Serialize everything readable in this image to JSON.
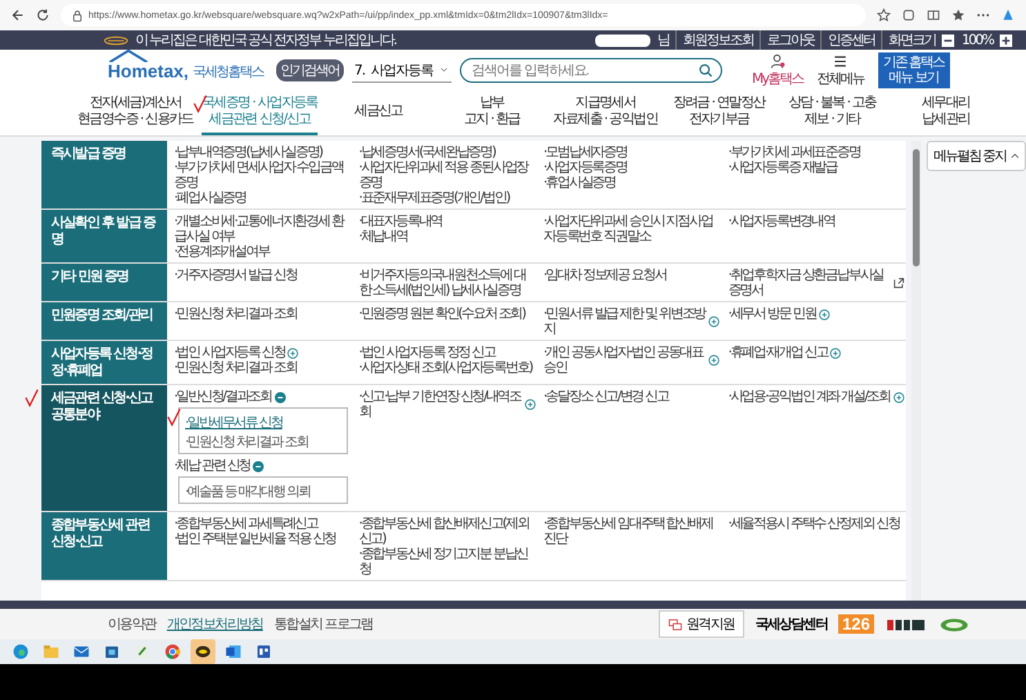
{
  "browser": {
    "url": "https://www.hometax.go.kr/websquare/websquare.wq?w2xPath=/ui/pp/index_pp.xml&tmIdx=0&tm2lIdx=100907&tm3lIdx="
  },
  "banner": {
    "notice": "이 누리집은 대한민국 공식 전자정부 누리집입니다.",
    "user_suffix": "님",
    "links": [
      "회원정보조회",
      "로그아웃",
      "인증센터",
      "화면크기"
    ],
    "zoom": "100%"
  },
  "header": {
    "logo": "Hometax,",
    "logo_subtitle": "국세청홈택스",
    "popular_label": "인기검색어",
    "popular_value": "7.  사업자등록",
    "search_placeholder": "검색어를 입력하세요.",
    "my_label": "My홈택스",
    "menu_label": "전체메뉴",
    "legacy_button": "기존 홈택스 메뉴 보기"
  },
  "nav": [
    {
      "lines": [
        "전자(세금)계산서",
        "현금영수증 · 신용카드"
      ],
      "selected": false,
      "annotated": false
    },
    {
      "lines": [
        "국세증명 · 사업자등록",
        "세금관련 신청/신고"
      ],
      "selected": true,
      "annotated": true
    },
    {
      "lines": [
        "세금신고"
      ],
      "selected": false,
      "annotated": false
    },
    {
      "lines": [
        "납부",
        "고지 · 환급"
      ],
      "selected": false,
      "annotated": false
    },
    {
      "lines": [
        "지급명세서",
        "자료제출 · 공익법인"
      ],
      "selected": false,
      "annotated": false
    },
    {
      "lines": [
        "장려금 · 연말정산",
        "전자기부금"
      ],
      "selected": false,
      "annotated": false
    },
    {
      "lines": [
        "상담 · 불복 · 고충",
        "제보 · 기타"
      ],
      "selected": false,
      "annotated": false
    },
    {
      "lines": [
        "세무대리",
        "납세관리"
      ],
      "selected": false,
      "annotated": false
    }
  ],
  "side_button": {
    "label": "메뉴펼침 중지"
  },
  "rows": [
    {
      "heading": "즉시발급 증명",
      "selected": false,
      "annotated": false,
      "columns": [
        [
          {
            "text": "·납부내역증명(납세사실증명)",
            "kind": "plain"
          },
          {
            "text": "·부가가치세 면세사업자 수입금액증명",
            "kind": "plain"
          },
          {
            "text": "·폐업사실증명",
            "kind": "plain"
          }
        ],
        [
          {
            "text": "·납세증명서(국세완납증명)",
            "kind": "plain"
          },
          {
            "text": "·사업자단위과세 적용 종된사업장증명",
            "kind": "plain"
          },
          {
            "text": "·표준재무제표증명(개인/법인)",
            "kind": "plain"
          }
        ],
        [
          {
            "text": "·모범납세자증명",
            "kind": "plain"
          },
          {
            "text": "·사업자등록증명",
            "kind": "plain"
          },
          {
            "text": "·휴업사실증명",
            "kind": "plain"
          }
        ],
        [
          {
            "text": "·부가가치세 과세표준증명",
            "kind": "plain"
          },
          {
            "text": "·사업자등록증 재발급",
            "kind": "plain"
          }
        ]
      ]
    },
    {
      "heading": "사실확인 후 발급 증명",
      "selected": false,
      "annotated": false,
      "columns": [
        [
          {
            "text": "·개별소비세·교통에너지환경세 환급사실 여부",
            "kind": "plain"
          },
          {
            "text": "·전용계좌개설여부",
            "kind": "plain"
          }
        ],
        [
          {
            "text": "·대표자등록내역",
            "kind": "plain"
          },
          {
            "text": "·체납내역",
            "kind": "plain"
          }
        ],
        [
          {
            "text": "·사업자단위과세 승인시 지점사업자등록번호 직권말소",
            "kind": "plain"
          }
        ],
        [
          {
            "text": "·사업자등록변경내역",
            "kind": "plain"
          }
        ]
      ]
    },
    {
      "heading": "기타 민원 증명",
      "selected": false,
      "annotated": false,
      "columns": [
        [
          {
            "text": "·거주자증명서 발급 신청",
            "kind": "plain"
          }
        ],
        [
          {
            "text": "·비거주자등의국내원천소득에 대한 소득세(법인세) 납세사실증명",
            "kind": "plain"
          }
        ],
        [
          {
            "text": "·임대차 정보제공 요청서",
            "kind": "plain"
          }
        ],
        [
          {
            "text": "·취업후학자금 상환금납부사실증명서",
            "kind": "external"
          }
        ]
      ]
    },
    {
      "heading": "민원증명 조회/관리",
      "selected": false,
      "annotated": false,
      "columns": [
        [
          {
            "text": "·민원신청 처리결과 조회",
            "kind": "plain"
          }
        ],
        [
          {
            "text": "·민원증명 원본 확인(수요처 조회)",
            "kind": "plain"
          }
        ],
        [
          {
            "text": "·민원서류 발급 제한 및 위변조방지",
            "kind": "plus"
          }
        ],
        [
          {
            "text": "·세무서 방문 민원",
            "kind": "plus"
          }
        ]
      ]
    },
    {
      "heading": "사업자등록 신청·정정·휴폐업",
      "selected": false,
      "annotated": false,
      "columns": [
        [
          {
            "text": "·법인 사업자등록 신청",
            "kind": "plus"
          },
          {
            "text": "·민원신청 처리결과 조회",
            "kind": "plain"
          }
        ],
        [
          {
            "text": "·법인 사업자등록 정정 신고",
            "kind": "plain"
          },
          {
            "text": "·사업자상태 조회(사업자등록번호)",
            "kind": "plain"
          }
        ],
        [
          {
            "text": "·개인 공동사업자·법인 공동대표 승인",
            "kind": "plus"
          }
        ],
        [
          {
            "text": "·휴폐업·재개업 신고",
            "kind": "plus"
          }
        ]
      ]
    },
    {
      "heading": "세금관련 신청·신고 공통분야",
      "selected": true,
      "annotated": true,
      "columns": [
        [
          {
            "text": "·일반신청/결과조회",
            "kind": "minus",
            "sub": [
              {
                "text": "·일반세무서류 신청",
                "kind": "link",
                "annotated": true
              },
              {
                "text": "·민원신청 처리결과 조회",
                "kind": "plain",
                "annotated": false
              }
            ]
          },
          {
            "text": "·체납 관련 신청",
            "kind": "minus",
            "sub": [
              {
                "text": "·예술품 등 매각대행 의뢰",
                "kind": "plain",
                "annotated": false
              }
            ]
          }
        ],
        [
          {
            "text": "·신고·납부 기한연장 신청/내역조회",
            "kind": "plus"
          }
        ],
        [
          {
            "text": "·송달장소 신고/변경 신고",
            "kind": "plain"
          }
        ],
        [
          {
            "text": "·사업용·공익법인 계좌 개설/조회",
            "kind": "plus"
          }
        ]
      ]
    },
    {
      "heading": "종합부동산세 관련 신청·신고",
      "selected": false,
      "annotated": false,
      "columns": [
        [
          {
            "text": "·종합부동산세 과세특례신고",
            "kind": "plain"
          },
          {
            "text": "·법인 주택분 일반세율 적용 신청",
            "kind": "plain"
          }
        ],
        [
          {
            "text": "·종합부동산세 합산배제신고(제외신고)",
            "kind": "plain"
          },
          {
            "text": "·종합부동산세 정기고지분 분납신청",
            "kind": "plain"
          }
        ],
        [
          {
            "text": "·종합부동산세 임대주택 합산배제 진단",
            "kind": "plain"
          }
        ],
        [
          {
            "text": "·세율적용시 주택수 산정제외 신청",
            "kind": "plain"
          }
        ]
      ]
    }
  ],
  "footer": {
    "links": [
      {
        "text": "이용약관",
        "selected": false
      },
      {
        "text": "개인정보처리방침",
        "selected": true
      },
      {
        "text": "통합설치 프로그램",
        "selected": false
      }
    ],
    "remote_button": "원격지원",
    "center_label": "국세상담센터",
    "center_number": "126"
  },
  "taskbar": [
    {
      "kind": "edge",
      "selected": false
    },
    {
      "kind": "folder",
      "selected": false
    },
    {
      "kind": "mail",
      "selected": false
    },
    {
      "kind": "store",
      "selected": false
    },
    {
      "kind": "notepad",
      "selected": false
    },
    {
      "kind": "chrome",
      "selected": false
    },
    {
      "kind": "chat",
      "selected": true
    },
    {
      "kind": "word",
      "selected": false
    },
    {
      "kind": "app",
      "selected": false
    }
  ]
}
